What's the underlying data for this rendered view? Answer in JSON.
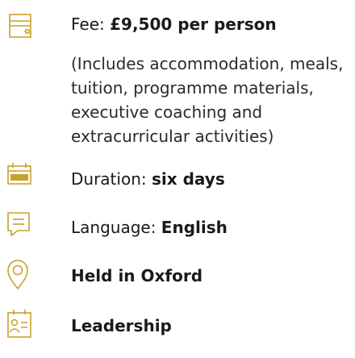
{
  "fee": {
    "label": "Fee: ",
    "value": "£9,500 per person",
    "description": "(Includes accommodation, meals, tuition, programme materials, executive coaching and extracurricular activities)",
    "icon": "receipt-icon"
  },
  "duration": {
    "label": "Duration: ",
    "value": "six days",
    "icon": "calendar-icon"
  },
  "language": {
    "label": "Language: ",
    "value": "English",
    "icon": "speech-bubble-icon"
  },
  "location": {
    "value": "Held in Oxford",
    "icon": "location-pin-icon"
  },
  "category": {
    "value": "Leadership",
    "icon": "profile-card-icon"
  },
  "colors": {
    "accent": "#c8a12b",
    "text": "#1a1a1a"
  }
}
